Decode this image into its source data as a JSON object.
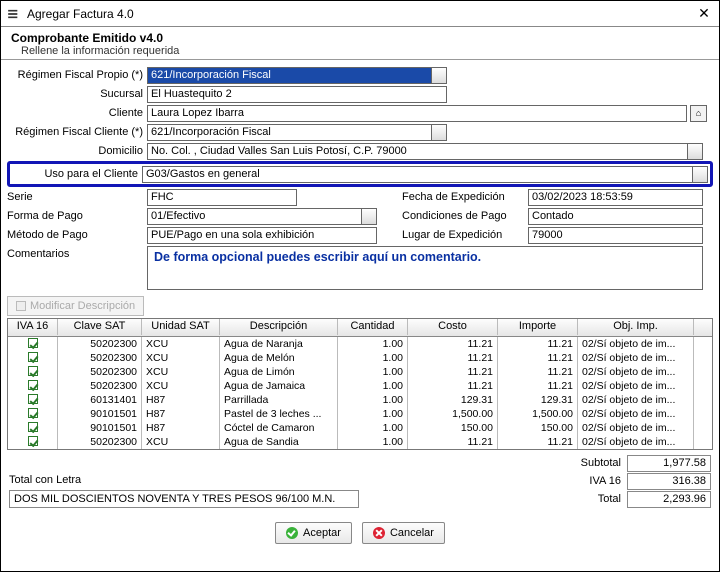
{
  "window": {
    "title": "Agregar Factura 4.0"
  },
  "header": {
    "title": "Comprobante Emitido v4.0",
    "subtitle": "Rellene la información requerida"
  },
  "form": {
    "regimen_propio": {
      "label": "Régimen Fiscal Propio (*)",
      "value": "621/Incorporación Fiscal"
    },
    "sucursal": {
      "label": "Sucursal",
      "value": "El Huastequito 2"
    },
    "cliente": {
      "label": "Cliente",
      "value": "Laura Lopez Ibarra"
    },
    "regimen_cliente": {
      "label": "Régimen Fiscal Cliente (*)",
      "value": "621/Incorporación Fiscal"
    },
    "domicilio": {
      "label": "Domicilio",
      "value": "No.  Col. , Ciudad Valles San Luis Potosí, C.P. 79000"
    },
    "uso_cliente": {
      "label": "Uso para el Cliente",
      "value": "G03/Gastos en general"
    },
    "serie": {
      "label": "Serie",
      "value": "FHC"
    },
    "fecha_exp": {
      "label": "Fecha de Expedición",
      "value": "03/02/2023 18:53:59"
    },
    "forma_pago": {
      "label": "Forma de Pago",
      "value": "01/Efectivo"
    },
    "cond_pago": {
      "label": "Condiciones de Pago",
      "value": "Contado"
    },
    "metodo_pago": {
      "label": "Método de Pago",
      "value": "PUE/Pago en una sola exhibición"
    },
    "lugar_exp": {
      "label": "Lugar de Expedición",
      "value": "79000"
    },
    "comentarios": {
      "label": "Comentarios",
      "placeholder_note": "De forma opcional puedes escribir aquí un comentario."
    }
  },
  "mod_desc_button": "Modificar Descripción",
  "grid": {
    "headers": {
      "iva": "IVA 16",
      "clave": "Clave SAT",
      "unidad": "Unidad SAT",
      "desc": "Descripción",
      "cant": "Cantidad",
      "costo": "Costo",
      "importe": "Importe",
      "obj": "Obj. Imp."
    },
    "rows": [
      {
        "chk": true,
        "clave": "50202300",
        "unidad": "XCU",
        "desc": "Agua de Naranja",
        "cant": "1.00",
        "costo": "11.21",
        "importe": "11.21",
        "obj": "02/Sí objeto de im..."
      },
      {
        "chk": true,
        "clave": "50202300",
        "unidad": "XCU",
        "desc": "Agua de Melón",
        "cant": "1.00",
        "costo": "11.21",
        "importe": "11.21",
        "obj": "02/Sí objeto de im..."
      },
      {
        "chk": true,
        "clave": "50202300",
        "unidad": "XCU",
        "desc": "Agua de Limón",
        "cant": "1.00",
        "costo": "11.21",
        "importe": "11.21",
        "obj": "02/Sí objeto de im..."
      },
      {
        "chk": true,
        "clave": "50202300",
        "unidad": "XCU",
        "desc": "Agua de Jamaica",
        "cant": "1.00",
        "costo": "11.21",
        "importe": "11.21",
        "obj": "02/Sí objeto de im..."
      },
      {
        "chk": true,
        "clave": "60131401",
        "unidad": "H87",
        "desc": "Parrillada",
        "cant": "1.00",
        "costo": "129.31",
        "importe": "129.31",
        "obj": "02/Sí objeto de im..."
      },
      {
        "chk": true,
        "clave": "90101501",
        "unidad": "H87",
        "desc": "Pastel de 3 leches ...",
        "cant": "1.00",
        "costo": "1,500.00",
        "importe": "1,500.00",
        "obj": "02/Sí objeto de im..."
      },
      {
        "chk": true,
        "clave": "90101501",
        "unidad": "H87",
        "desc": "Cóctel de Camaron",
        "cant": "1.00",
        "costo": "150.00",
        "importe": "150.00",
        "obj": "02/Sí objeto de im..."
      },
      {
        "chk": true,
        "clave": "50202300",
        "unidad": "XCU",
        "desc": "Agua de Sandia",
        "cant": "1.00",
        "costo": "11.21",
        "importe": "11.21",
        "obj": "02/Sí objeto de im..."
      }
    ]
  },
  "totals": {
    "subtotal": {
      "label": "Subtotal",
      "value": "1,977.58"
    },
    "iva": {
      "label": "IVA 16",
      "value": "316.38"
    },
    "total": {
      "label": "Total",
      "value": "2,293.96"
    },
    "letra_label": "Total con Letra",
    "letra_value": "DOS MIL DOSCIENTOS NOVENTA Y TRES PESOS 96/100 M.N."
  },
  "buttons": {
    "accept": "Aceptar",
    "cancel": "Cancelar"
  }
}
